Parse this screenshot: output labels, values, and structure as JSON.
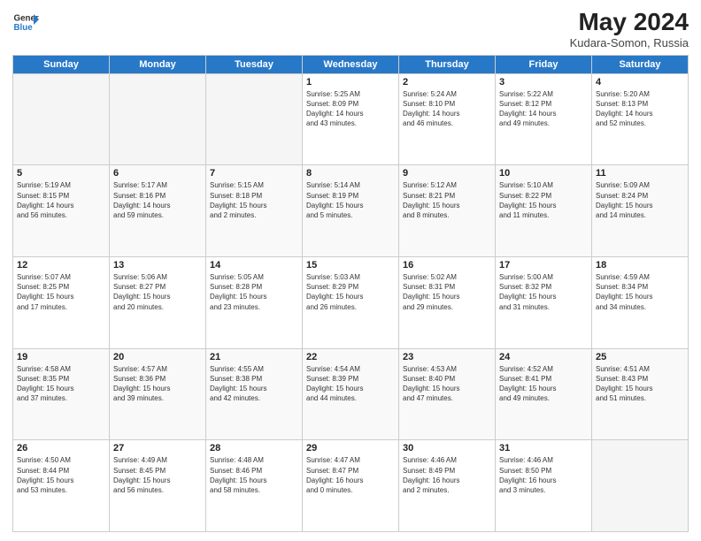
{
  "header": {
    "logo_general": "General",
    "logo_blue": "Blue",
    "month_year": "May 2024",
    "location": "Kudara-Somon, Russia"
  },
  "days_of_week": [
    "Sunday",
    "Monday",
    "Tuesday",
    "Wednesday",
    "Thursday",
    "Friday",
    "Saturday"
  ],
  "weeks": [
    [
      {
        "day": "",
        "info": ""
      },
      {
        "day": "",
        "info": ""
      },
      {
        "day": "",
        "info": ""
      },
      {
        "day": "1",
        "info": "Sunrise: 5:25 AM\nSunset: 8:09 PM\nDaylight: 14 hours\nand 43 minutes."
      },
      {
        "day": "2",
        "info": "Sunrise: 5:24 AM\nSunset: 8:10 PM\nDaylight: 14 hours\nand 46 minutes."
      },
      {
        "day": "3",
        "info": "Sunrise: 5:22 AM\nSunset: 8:12 PM\nDaylight: 14 hours\nand 49 minutes."
      },
      {
        "day": "4",
        "info": "Sunrise: 5:20 AM\nSunset: 8:13 PM\nDaylight: 14 hours\nand 52 minutes."
      }
    ],
    [
      {
        "day": "5",
        "info": "Sunrise: 5:19 AM\nSunset: 8:15 PM\nDaylight: 14 hours\nand 56 minutes."
      },
      {
        "day": "6",
        "info": "Sunrise: 5:17 AM\nSunset: 8:16 PM\nDaylight: 14 hours\nand 59 minutes."
      },
      {
        "day": "7",
        "info": "Sunrise: 5:15 AM\nSunset: 8:18 PM\nDaylight: 15 hours\nand 2 minutes."
      },
      {
        "day": "8",
        "info": "Sunrise: 5:14 AM\nSunset: 8:19 PM\nDaylight: 15 hours\nand 5 minutes."
      },
      {
        "day": "9",
        "info": "Sunrise: 5:12 AM\nSunset: 8:21 PM\nDaylight: 15 hours\nand 8 minutes."
      },
      {
        "day": "10",
        "info": "Sunrise: 5:10 AM\nSunset: 8:22 PM\nDaylight: 15 hours\nand 11 minutes."
      },
      {
        "day": "11",
        "info": "Sunrise: 5:09 AM\nSunset: 8:24 PM\nDaylight: 15 hours\nand 14 minutes."
      }
    ],
    [
      {
        "day": "12",
        "info": "Sunrise: 5:07 AM\nSunset: 8:25 PM\nDaylight: 15 hours\nand 17 minutes."
      },
      {
        "day": "13",
        "info": "Sunrise: 5:06 AM\nSunset: 8:27 PM\nDaylight: 15 hours\nand 20 minutes."
      },
      {
        "day": "14",
        "info": "Sunrise: 5:05 AM\nSunset: 8:28 PM\nDaylight: 15 hours\nand 23 minutes."
      },
      {
        "day": "15",
        "info": "Sunrise: 5:03 AM\nSunset: 8:29 PM\nDaylight: 15 hours\nand 26 minutes."
      },
      {
        "day": "16",
        "info": "Sunrise: 5:02 AM\nSunset: 8:31 PM\nDaylight: 15 hours\nand 29 minutes."
      },
      {
        "day": "17",
        "info": "Sunrise: 5:00 AM\nSunset: 8:32 PM\nDaylight: 15 hours\nand 31 minutes."
      },
      {
        "day": "18",
        "info": "Sunrise: 4:59 AM\nSunset: 8:34 PM\nDaylight: 15 hours\nand 34 minutes."
      }
    ],
    [
      {
        "day": "19",
        "info": "Sunrise: 4:58 AM\nSunset: 8:35 PM\nDaylight: 15 hours\nand 37 minutes."
      },
      {
        "day": "20",
        "info": "Sunrise: 4:57 AM\nSunset: 8:36 PM\nDaylight: 15 hours\nand 39 minutes."
      },
      {
        "day": "21",
        "info": "Sunrise: 4:55 AM\nSunset: 8:38 PM\nDaylight: 15 hours\nand 42 minutes."
      },
      {
        "day": "22",
        "info": "Sunrise: 4:54 AM\nSunset: 8:39 PM\nDaylight: 15 hours\nand 44 minutes."
      },
      {
        "day": "23",
        "info": "Sunrise: 4:53 AM\nSunset: 8:40 PM\nDaylight: 15 hours\nand 47 minutes."
      },
      {
        "day": "24",
        "info": "Sunrise: 4:52 AM\nSunset: 8:41 PM\nDaylight: 15 hours\nand 49 minutes."
      },
      {
        "day": "25",
        "info": "Sunrise: 4:51 AM\nSunset: 8:43 PM\nDaylight: 15 hours\nand 51 minutes."
      }
    ],
    [
      {
        "day": "26",
        "info": "Sunrise: 4:50 AM\nSunset: 8:44 PM\nDaylight: 15 hours\nand 53 minutes."
      },
      {
        "day": "27",
        "info": "Sunrise: 4:49 AM\nSunset: 8:45 PM\nDaylight: 15 hours\nand 56 minutes."
      },
      {
        "day": "28",
        "info": "Sunrise: 4:48 AM\nSunset: 8:46 PM\nDaylight: 15 hours\nand 58 minutes."
      },
      {
        "day": "29",
        "info": "Sunrise: 4:47 AM\nSunset: 8:47 PM\nDaylight: 16 hours\nand 0 minutes."
      },
      {
        "day": "30",
        "info": "Sunrise: 4:46 AM\nSunset: 8:49 PM\nDaylight: 16 hours\nand 2 minutes."
      },
      {
        "day": "31",
        "info": "Sunrise: 4:46 AM\nSunset: 8:50 PM\nDaylight: 16 hours\nand 3 minutes."
      },
      {
        "day": "",
        "info": ""
      }
    ]
  ]
}
